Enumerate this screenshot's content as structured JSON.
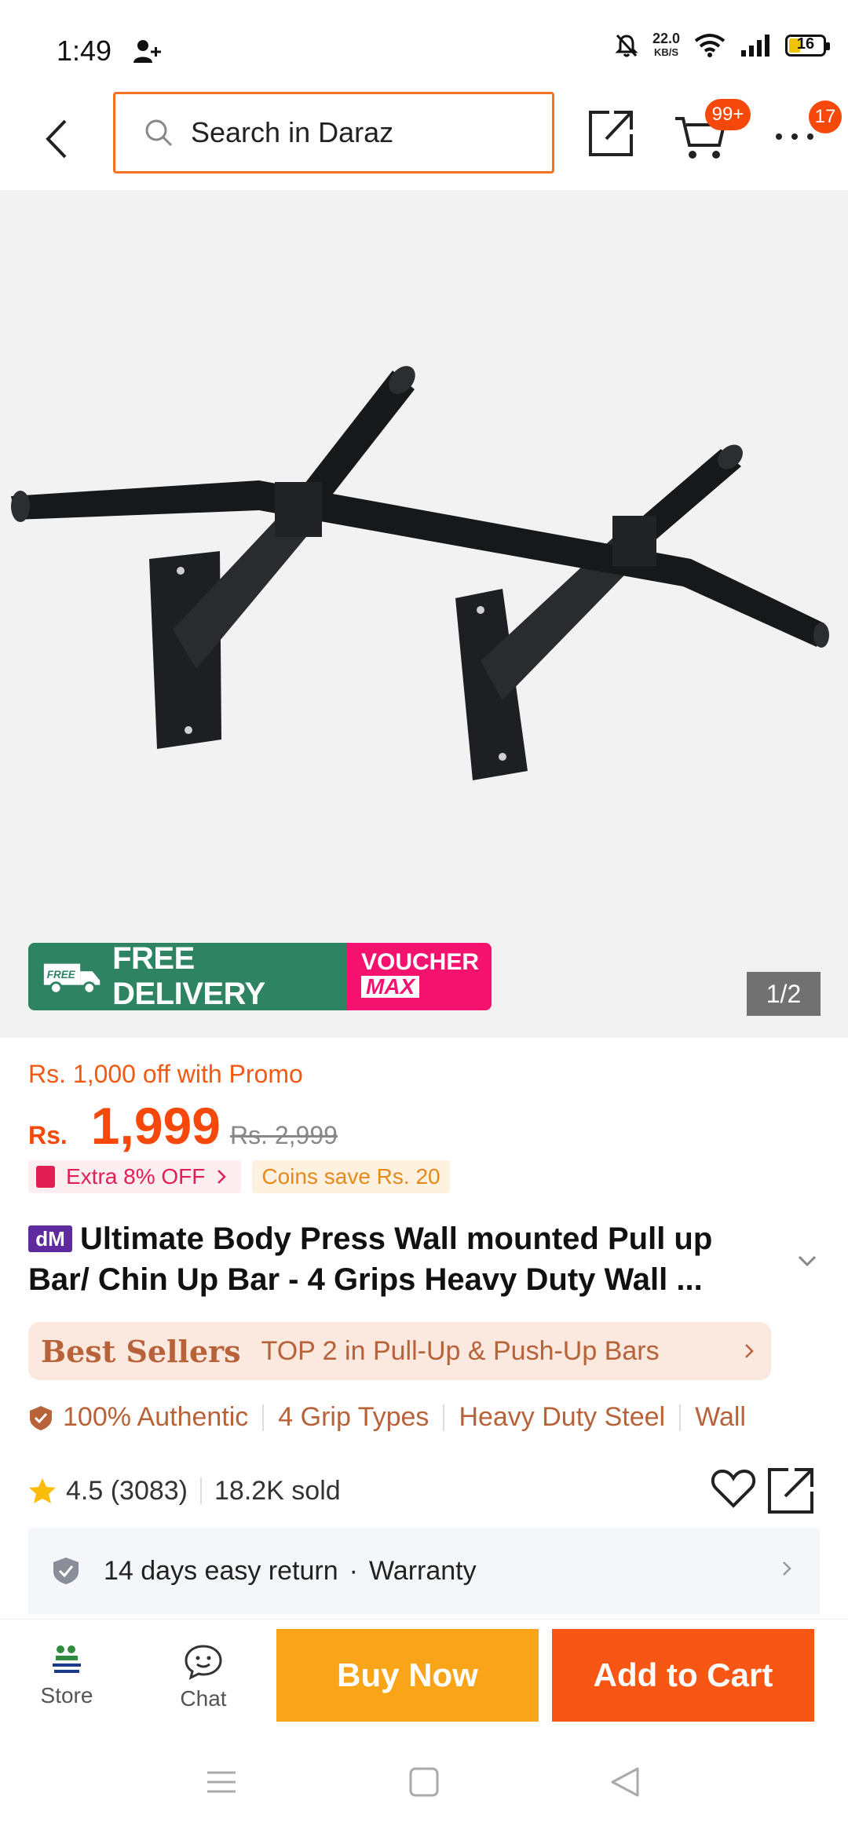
{
  "status_bar": {
    "time": "1:49",
    "speed_value": "22.0",
    "speed_unit": "KB/S",
    "battery": "16"
  },
  "header": {
    "search_placeholder": "Search in Daraz",
    "cart_badge": "99+",
    "more_badge": "17"
  },
  "hero": {
    "promo_free": "FREE DELIVERY",
    "promo_free_icon_text": "FREE",
    "voucher_line1": "VOUCHER",
    "voucher_line2": "MAX",
    "image_counter": "1/2"
  },
  "price": {
    "promo_text": "Rs. 1,000 off with Promo",
    "currency": "Rs.",
    "current": "1,999",
    "original": "Rs. 2,999",
    "extra_tag": "Extra 8% OFF",
    "coins_tag": "Coins save Rs. 20"
  },
  "product": {
    "brand_badge": "dM",
    "title": "Ultimate Body Press Wall mounted Pull up Bar/ Chin Up Bar - 4 Grips Heavy Duty Wall ..."
  },
  "best_sellers": {
    "logo": "Best Sellers",
    "text": "TOP 2 in Pull-Up & Push-Up Bars"
  },
  "features": [
    "100% Authentic",
    "4 Grip Types",
    "Heavy Duty Steel",
    "Wall"
  ],
  "rating": {
    "score": "4.5",
    "count": "(3083)",
    "sold": "18.2K sold"
  },
  "return_policy": {
    "returns": "14 days easy return",
    "dot": "·",
    "warranty": "Warranty"
  },
  "actions": {
    "store": "Store",
    "chat": "Chat",
    "buy_now": "Buy Now",
    "add_to_cart": "Add to Cart"
  },
  "colors": {
    "accent": "#f57224",
    "price": "#f5480a",
    "buy": "#faa41a",
    "cart": "#f75614",
    "free_delivery": "#2e8462",
    "voucher": "#f5126f"
  }
}
